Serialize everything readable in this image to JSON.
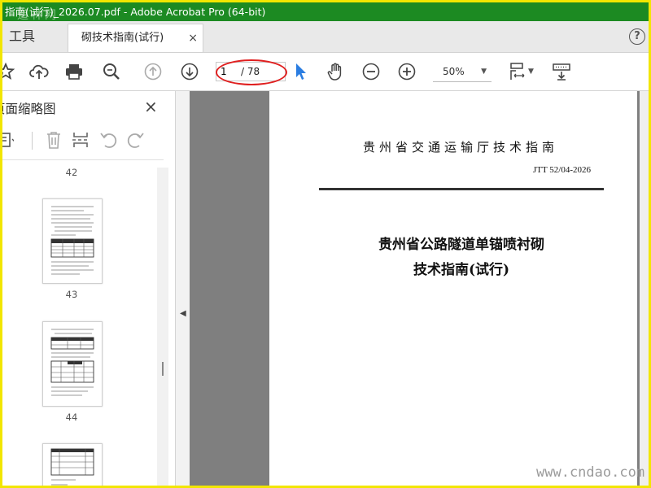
{
  "window": {
    "title": "指南(试行)_2026.07.pdf - Adobe Acrobat Pro (64-bit)",
    "watermark_top": "道林网"
  },
  "tabs": {
    "tools_label": "工具",
    "document_tab_label": "砌技术指南(试行)",
    "document_tab_close": "×",
    "help_label": "?"
  },
  "toolbar": {
    "current_page": "1",
    "total_pages": "/ 78",
    "zoom_value": "50%",
    "icons": [
      "bookmark-star-icon",
      "upload-icon",
      "print-icon",
      "zoom-search-icon",
      "page-up-icon",
      "page-down-icon",
      "select-cursor-icon",
      "hand-icon",
      "zoom-out-icon",
      "zoom-in-icon",
      "page-fit-icon",
      "read-mode-icon"
    ],
    "colors": {
      "cursor_blue": "#2a7de1",
      "annotation_red": "#e02020"
    }
  },
  "sidebar": {
    "title": "页面缩略图",
    "close_label": "×",
    "tool_icons": [
      "page-options-icon",
      "delete-icon",
      "extract-icon",
      "rotate-left-icon",
      "rotate-right-icon"
    ],
    "thumbnails": [
      {
        "label": "42"
      },
      {
        "label": "43"
      },
      {
        "label": "44"
      },
      {
        "label": ""
      }
    ]
  },
  "document": {
    "header": "贵州省交通运输厅技术指南",
    "code": "JTT 52/04-2026",
    "title_line1": "贵州省公路隧道单锚喷衬砌",
    "title_line2": "技术指南(试行)"
  },
  "watermark_bottom": "www.cndao.com",
  "colors": {
    "titlebar_bg": "#1c8a22",
    "frame_border": "#f2e600",
    "doc_background": "#7f7f7f"
  }
}
